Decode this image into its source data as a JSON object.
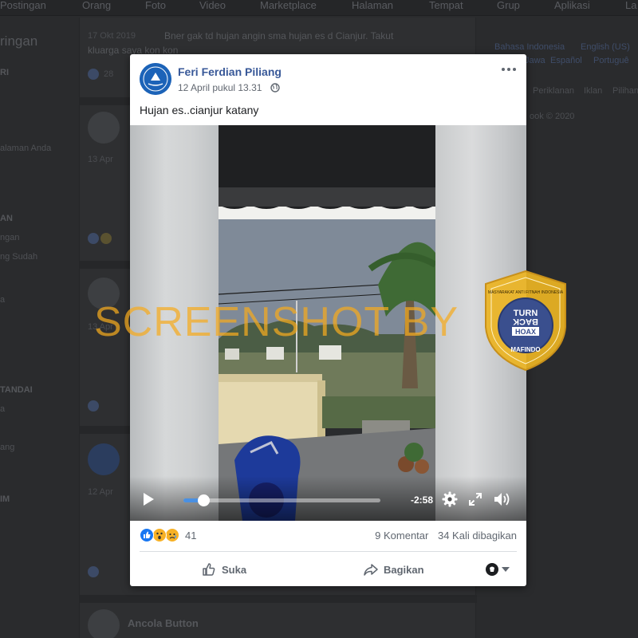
{
  "topnav": {
    "items": [
      "Postingan",
      "Orang",
      "Foto",
      "Video",
      "Marketplace",
      "Halaman",
      "Tempat",
      "Grup",
      "Aplikasi",
      "La"
    ]
  },
  "left_sidebar": {
    "heading": "ringan",
    "items": [
      "RI",
      "alaman Anda",
      "AN",
      "ngan",
      "ng Sudah",
      "a",
      "TANDAI",
      "a",
      "ang",
      "IM"
    ]
  },
  "background_feed": {
    "top_post_date": "17 Okt 2019",
    "top_post_text_line1": "Bner gak td hujan angin sma hujan es d Cianjur. Takut",
    "top_post_text_line2": "kluarga saya kon kon",
    "top_post_count": "28",
    "dates": [
      "13 Apr",
      "13 Apr",
      "12 Apr"
    ],
    "bottom_name": "Ancola Button"
  },
  "right_sidebar": {
    "languages_line1": [
      "Bahasa Indonesia",
      "English (US)"
    ],
    "languages_line2": [
      "Jawa",
      "Español",
      "Portuguê"
    ],
    "links": [
      "Periklanan",
      "Iklan",
      "Pilihan"
    ],
    "copyright": "ook © 2020"
  },
  "post": {
    "author": "Feri Ferdian Piliang",
    "timestamp": "12 April pukul 13.31",
    "text": "Hujan es..cianjur katany",
    "video": {
      "time_remaining": "-2:58",
      "progress": 0.1
    },
    "reactions": {
      "count": "41",
      "types": [
        "like-icon",
        "wow-icon",
        "sad-icon"
      ]
    },
    "comments": "9 Komentar",
    "shares": "34 Kali dibagikan",
    "actions": {
      "like_label": "Suka",
      "share_label": "Bagikan"
    }
  },
  "watermark": {
    "text": "SCREENSHOT BY",
    "badge_line1": "TURN",
    "badge_line2": "BACK",
    "badge_line3": "HOAX",
    "badge_org": "MAFINDO",
    "badge_ring": "MASYARAKAT ANTI FITNAH INDONESIA",
    "color": "#f5a623"
  }
}
